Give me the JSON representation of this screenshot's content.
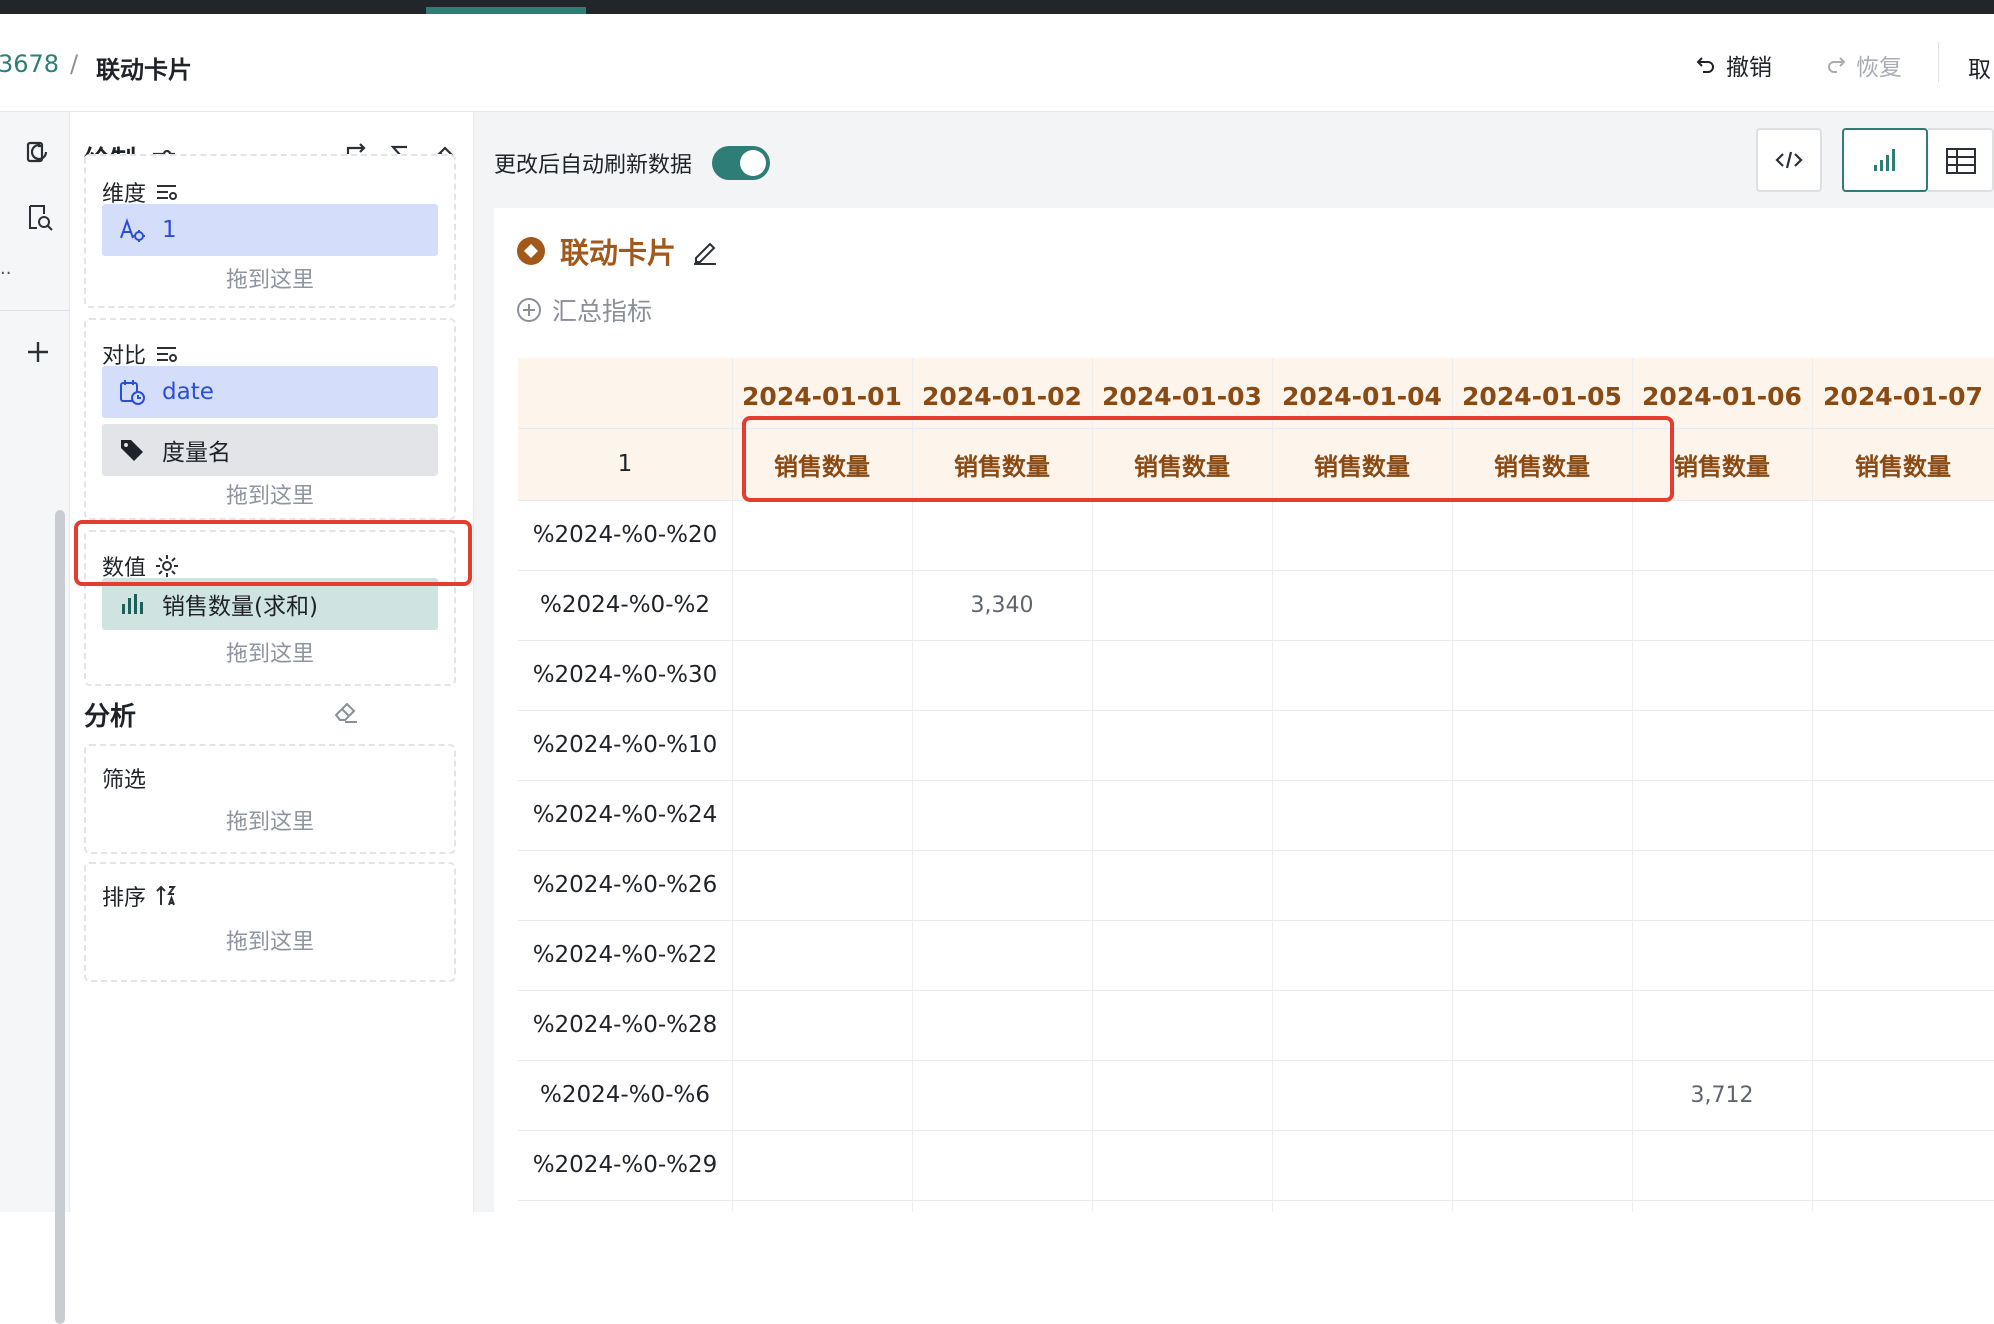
{
  "header": {
    "breadcrumb_id": "3678",
    "breadcrumb_sep": "/",
    "breadcrumb_title": "联动卡片",
    "undo_label": "撤销",
    "redo_label": "恢复",
    "cancel_label": "取"
  },
  "panel": {
    "title": "绘制",
    "dimension": {
      "title": "维度",
      "chip": "1",
      "drop": "拖到这里"
    },
    "compare": {
      "title": "对比",
      "chips": [
        "date",
        "度量名"
      ],
      "drop": "拖到这里"
    },
    "value": {
      "title": "数值",
      "chip": "销售数量(求和)",
      "drop": "拖到这里"
    },
    "analysis_title": "分析",
    "filter": {
      "title": "筛选",
      "drop": "拖到这里"
    },
    "sort": {
      "title": "排序",
      "drop": "拖到这里"
    }
  },
  "main": {
    "auto_refresh_label": "更改后自动刷新数据",
    "auto_refresh_on": true,
    "card_title": "联动卡片",
    "sum_metric_label": "汇总指标"
  },
  "table": {
    "corner_label": "1",
    "dates": [
      "2024-01-01",
      "2024-01-02",
      "2024-01-03",
      "2024-01-04",
      "2024-01-05",
      "2024-01-06",
      "2024-01-07"
    ],
    "measure_label": "销售数量",
    "rows": [
      {
        "label": "%2024-%0-%20",
        "values": [
          "",
          "",
          "",
          "",
          "",
          "",
          ""
        ]
      },
      {
        "label": "%2024-%0-%2",
        "values": [
          "",
          "3,340",
          "",
          "",
          "",
          "",
          ""
        ]
      },
      {
        "label": "%2024-%0-%30",
        "values": [
          "",
          "",
          "",
          "",
          "",
          "",
          ""
        ]
      },
      {
        "label": "%2024-%0-%10",
        "values": [
          "",
          "",
          "",
          "",
          "",
          "",
          ""
        ]
      },
      {
        "label": "%2024-%0-%24",
        "values": [
          "",
          "",
          "",
          "",
          "",
          "",
          ""
        ]
      },
      {
        "label": "%2024-%0-%26",
        "values": [
          "",
          "",
          "",
          "",
          "",
          "",
          ""
        ]
      },
      {
        "label": "%2024-%0-%22",
        "values": [
          "",
          "",
          "",
          "",
          "",
          "",
          ""
        ]
      },
      {
        "label": "%2024-%0-%28",
        "values": [
          "",
          "",
          "",
          "",
          "",
          "",
          ""
        ]
      },
      {
        "label": "%2024-%0-%6",
        "values": [
          "",
          "",
          "",
          "",
          "",
          "3,712",
          ""
        ]
      },
      {
        "label": "%2024-%0-%29",
        "values": [
          "",
          "",
          "",
          "",
          "",
          "",
          ""
        ]
      }
    ]
  },
  "colors": {
    "accent": "#2e7d76",
    "header_text": "#8a4a14",
    "highlight": "#e43d2f",
    "chip_blue": "#d4defb",
    "chip_green": "#cfe3e1"
  }
}
